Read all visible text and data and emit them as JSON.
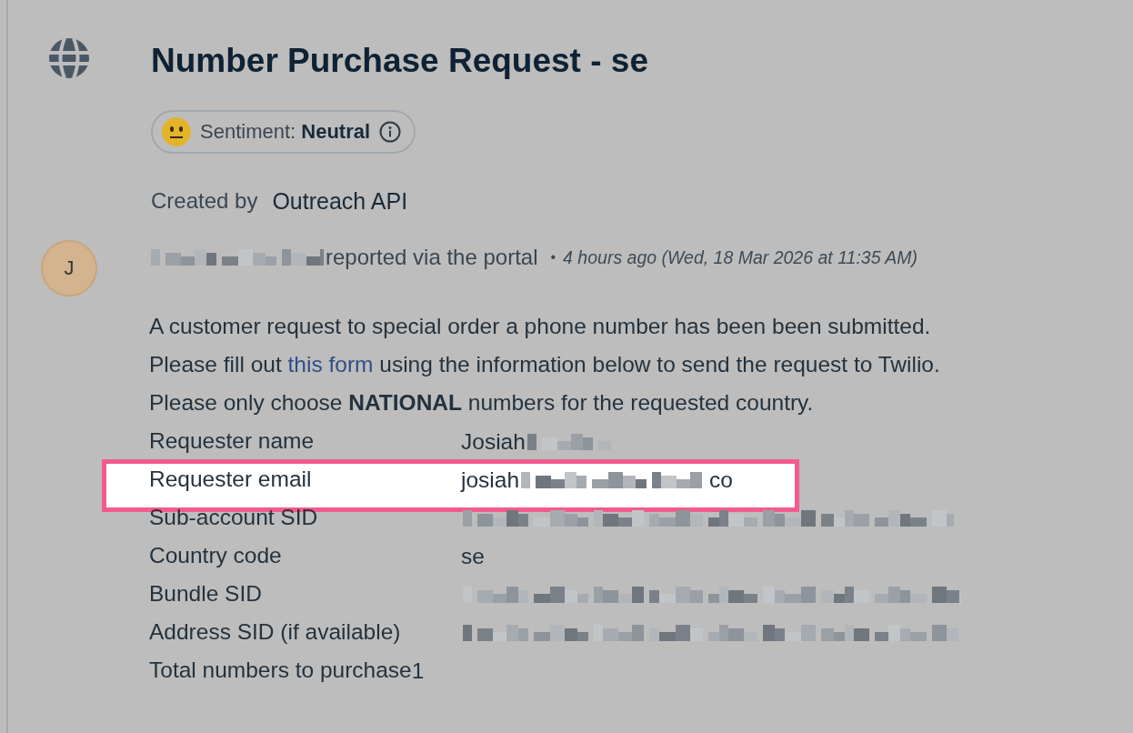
{
  "header": {
    "title": "Number Purchase Request - se",
    "sentiment": {
      "label": "Sentiment:",
      "value": "Neutral"
    },
    "created_by": {
      "label": "Created by",
      "name": "Outreach API"
    }
  },
  "message": {
    "avatar": "J",
    "reporter_redacted": true,
    "action": "reported via the portal",
    "separator": "•",
    "time": "4 hours ago (Wed, 18 Mar 2026 at 11:35 AM)",
    "lines": [
      [
        {
          "kind": "text",
          "text": "A customer request to special order a phone number has been been submitted."
        }
      ],
      [
        {
          "kind": "text",
          "text": "Please fill out "
        },
        {
          "kind": "link",
          "text": "this form"
        },
        {
          "kind": "text",
          "text": " using the information below to send the request to Twilio."
        }
      ],
      [
        {
          "kind": "text",
          "text": "Please only choose **NATIONAL** numbers for the requested country."
        }
      ]
    ],
    "fields": [
      {
        "kind": "pair",
        "label": "Requester name",
        "highlighted": false,
        "value": [
          {
            "kind": "text",
            "text": "Josiah"
          },
          {
            "kind": "redacted"
          }
        ]
      },
      {
        "kind": "pair",
        "label": "Requester email",
        "highlighted": true,
        "value": [
          {
            "kind": "text",
            "text": "josiah"
          },
          {
            "kind": "redacted"
          },
          {
            "kind": "text",
            "text": "co"
          }
        ]
      },
      {
        "kind": "pair",
        "label": "Sub-account SID",
        "highlighted": false,
        "value": [
          {
            "kind": "redacted"
          }
        ]
      },
      {
        "kind": "pair",
        "label": "Country code",
        "highlighted": false,
        "value": [
          {
            "kind": "text",
            "text": "se"
          }
        ]
      },
      {
        "kind": "pair",
        "label": "Bundle SID",
        "highlighted": false,
        "value": [
          {
            "kind": "redacted"
          }
        ]
      },
      {
        "kind": "pair",
        "label": "Address SID (if available)",
        "highlighted": false,
        "value": [
          {
            "kind": "redacted"
          }
        ]
      },
      {
        "kind": "inline",
        "label": "Total numbers to purchase",
        "highlighted": false,
        "value": [
          {
            "kind": "text",
            "text": "1"
          }
        ]
      }
    ]
  }
}
